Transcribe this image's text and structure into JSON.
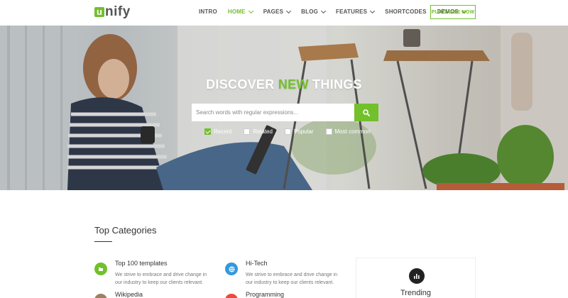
{
  "header": {
    "logo": {
      "mark": "u",
      "text": "nify"
    },
    "nav": [
      {
        "label": "INTRO",
        "active": false,
        "dropdown": false
      },
      {
        "label": "HOME",
        "active": true,
        "dropdown": true
      },
      {
        "label": "PAGES",
        "active": false,
        "dropdown": true
      },
      {
        "label": "BLOG",
        "active": false,
        "dropdown": true
      },
      {
        "label": "FEATURES",
        "active": false,
        "dropdown": true
      },
      {
        "label": "SHORTCODES",
        "active": false,
        "dropdown": false
      },
      {
        "label": "DEMOS",
        "active": false,
        "dropdown": true
      }
    ],
    "purchase_label": "PURCHASE NOW"
  },
  "hero": {
    "title_pre": "DISCOVER ",
    "title_highlight": "NEW",
    "title_post": " THINGS",
    "search_placeholder": "Search words with regular expressions...",
    "filters": [
      {
        "label": "Recent",
        "checked": true
      },
      {
        "label": "Related",
        "checked": false
      },
      {
        "label": "Popular",
        "checked": false
      },
      {
        "label": "Most common",
        "checked": false
      }
    ]
  },
  "categories_section": {
    "title": "Top Categories",
    "items": [
      {
        "title": "Top 100 templates",
        "desc": "We strive to embrace and drive change in our industry to keep our clients relevant.",
        "icon": "folder-icon",
        "color": "#72c02c"
      },
      {
        "title": "Hi-Tech",
        "desc": "We strive to embrace and drive change in our industry to keep our clients relevant.",
        "icon": "globe-icon",
        "color": "#3498db"
      },
      {
        "title": "Wikipedia",
        "desc": "",
        "icon": "book-icon",
        "color": "#9c8061"
      },
      {
        "title": "Programming",
        "desc": "",
        "icon": "code-icon",
        "color": "#e74c3c"
      }
    ],
    "trending": {
      "label": "Trending",
      "icon": "bar-chart-icon"
    }
  },
  "colors": {
    "accent": "#72c02c",
    "text": "#333333"
  }
}
